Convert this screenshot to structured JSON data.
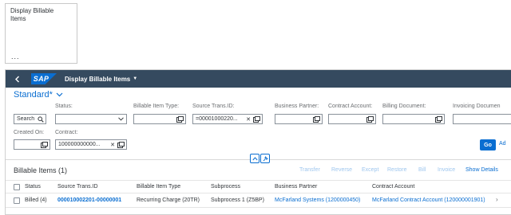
{
  "tile": {
    "title": "Display Billable Items",
    "more": "..."
  },
  "shell": {
    "logo": "SAP",
    "title": "Display Billable Items",
    "caret": "▼"
  },
  "variant": {
    "label": "Standard",
    "marker": "*"
  },
  "filters": {
    "search_placeholder": "Search",
    "status_label": "Status:",
    "status_value": "",
    "billable_item_type_label": "Billable Item Type:",
    "billable_item_type_value": "",
    "source_trans_id_label": "Source Trans.ID:",
    "source_trans_id_value": "=00001000220...",
    "business_partner_label": "Business Partner:",
    "business_partner_value": "",
    "contract_account_label": "Contract Account:",
    "contract_account_value": "",
    "billing_document_label": "Billing Document:",
    "billing_document_value": "",
    "invoicing_document_label": "Invoicing Documen",
    "invoicing_document_value": "",
    "created_on_label": "Created On:",
    "created_on_value": "",
    "contract_label": "Contract:",
    "contract_value": "100000000000..."
  },
  "actions": {
    "go": "Go",
    "adapt": "Ad"
  },
  "table": {
    "title": "Billable Items (1)",
    "toolbar": [
      "Transfer",
      "Reverse",
      "Except",
      "Restore",
      "Bill",
      "Invoice"
    ],
    "show_details": "Show Details",
    "columns": [
      "Status",
      "Source Trans.ID",
      "Billable Item Type",
      "Subprocess",
      "Business Partner",
      "Contract Account"
    ],
    "rows": [
      {
        "status": "Billed (4)",
        "source_trans_id": "000010002201-00000001",
        "billable_item_type": "Recurring Charge (20TR)",
        "subprocess": "Subprocess 1 (Z5BP)",
        "business_partner": "McFarland Systems (1200000450)",
        "contract_account": "McFarland Contract Account (120000001901)"
      }
    ],
    "row_nav": "›"
  },
  "colors": {
    "shell_bg": "#354a5f",
    "accent": "#0a6ed1",
    "disabled_action": "#9ec6ee"
  }
}
